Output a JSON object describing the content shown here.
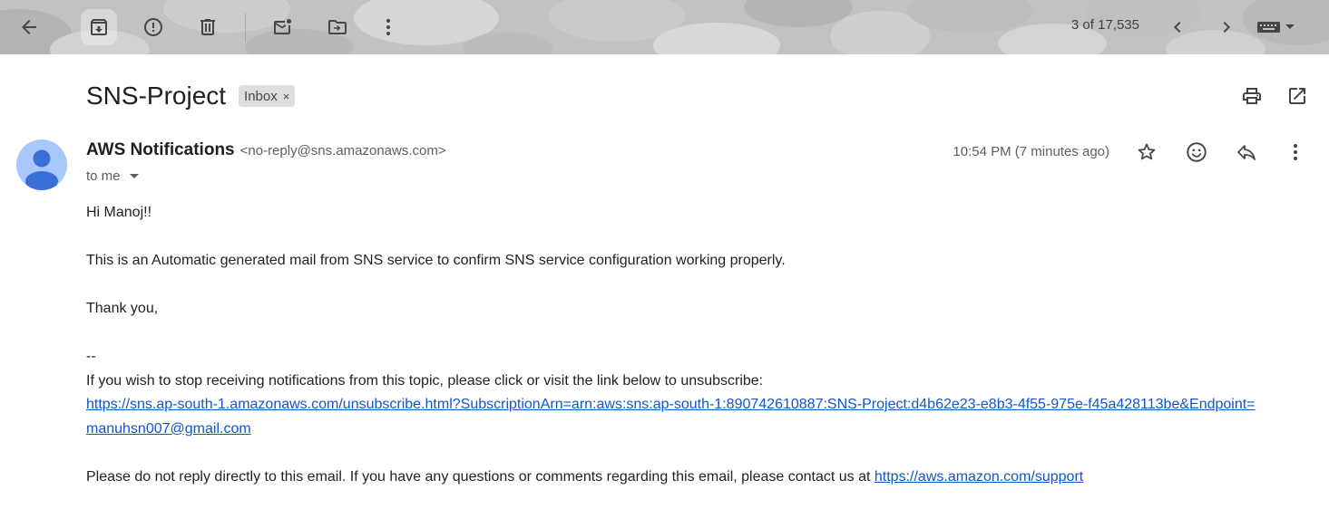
{
  "toolbar": {
    "counter": "3 of 17,535",
    "icons": [
      "back-arrow-icon",
      "archive-icon",
      "report-spam-icon",
      "delete-icon",
      "mark-unread-icon",
      "move-to-icon",
      "more-vertical-icon",
      "chevron-left-icon",
      "chevron-right-icon",
      "keyboard-icon",
      "caret-down-icon"
    ]
  },
  "email": {
    "subject": "SNS-Project",
    "label": "Inbox",
    "label_remove": "×",
    "sender_name": "AWS Notifications",
    "sender_email": "<no-reply@sns.amazonaws.com>",
    "recipient": "to me",
    "time": "10:54 PM (7 minutes ago)",
    "body": {
      "greeting": "Hi Manoj!!",
      "message": "This is an Automatic generated mail from SNS service to confirm SNS service configuration working properly.",
      "thanks": "Thank you,",
      "signature_sep": "--",
      "unsubscribe_intro": "If you wish to stop receiving notifications from this topic, please click or visit the link below to unsubscribe:",
      "unsubscribe_link": "https://sns.ap-south-1.amazonaws.com/unsubscribe.html?SubscriptionArn=arn:aws:sns:ap-south-1:890742610887:SNS-Project:d4b62e23-e8b3-4f55-975e-f45a428113be&Endpoint=manuhsn007@gmail.com",
      "footer_text": "Please do not reply directly to this email. If you have any questions or comments regarding this email, please contact us at ",
      "support_link": "https://aws.amazon.com/support"
    }
  },
  "colors": {
    "toolbar_bg": "#c4c4c4",
    "link": "#1155cc",
    "avatar_bg": "#a8c7fa",
    "avatar_fg": "#3a6fd8",
    "label_chip_bg": "#dddddd"
  }
}
